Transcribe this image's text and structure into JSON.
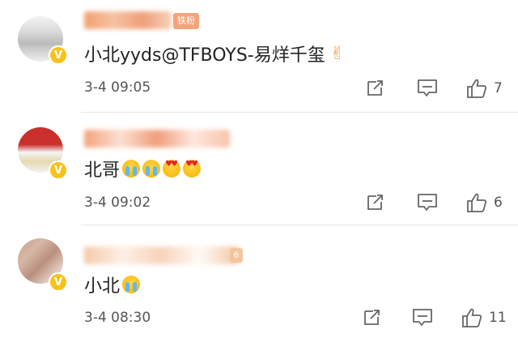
{
  "colors": {
    "vip_badge": "#f7c21c",
    "fan_badge": "#f2a57a",
    "icon": "#666666",
    "divider": "#e6e6e6"
  },
  "icons": {
    "share": "share-icon",
    "comment": "comment-icon",
    "like": "thumbs-up-icon",
    "verified": "verified-v-icon"
  },
  "comments": [
    {
      "badge": "铁粉",
      "verified": "V",
      "text": "小北yyds@TFBOYS-易烊千玺",
      "emoji": "✌",
      "time": "3-4 09:05",
      "likes": "7"
    },
    {
      "verified": "V",
      "text": "北哥",
      "time": "3-4 09:02",
      "likes": "6"
    },
    {
      "level": "6",
      "verified": "V",
      "text": "小北",
      "time": "3-4 08:30",
      "likes": "11"
    }
  ]
}
